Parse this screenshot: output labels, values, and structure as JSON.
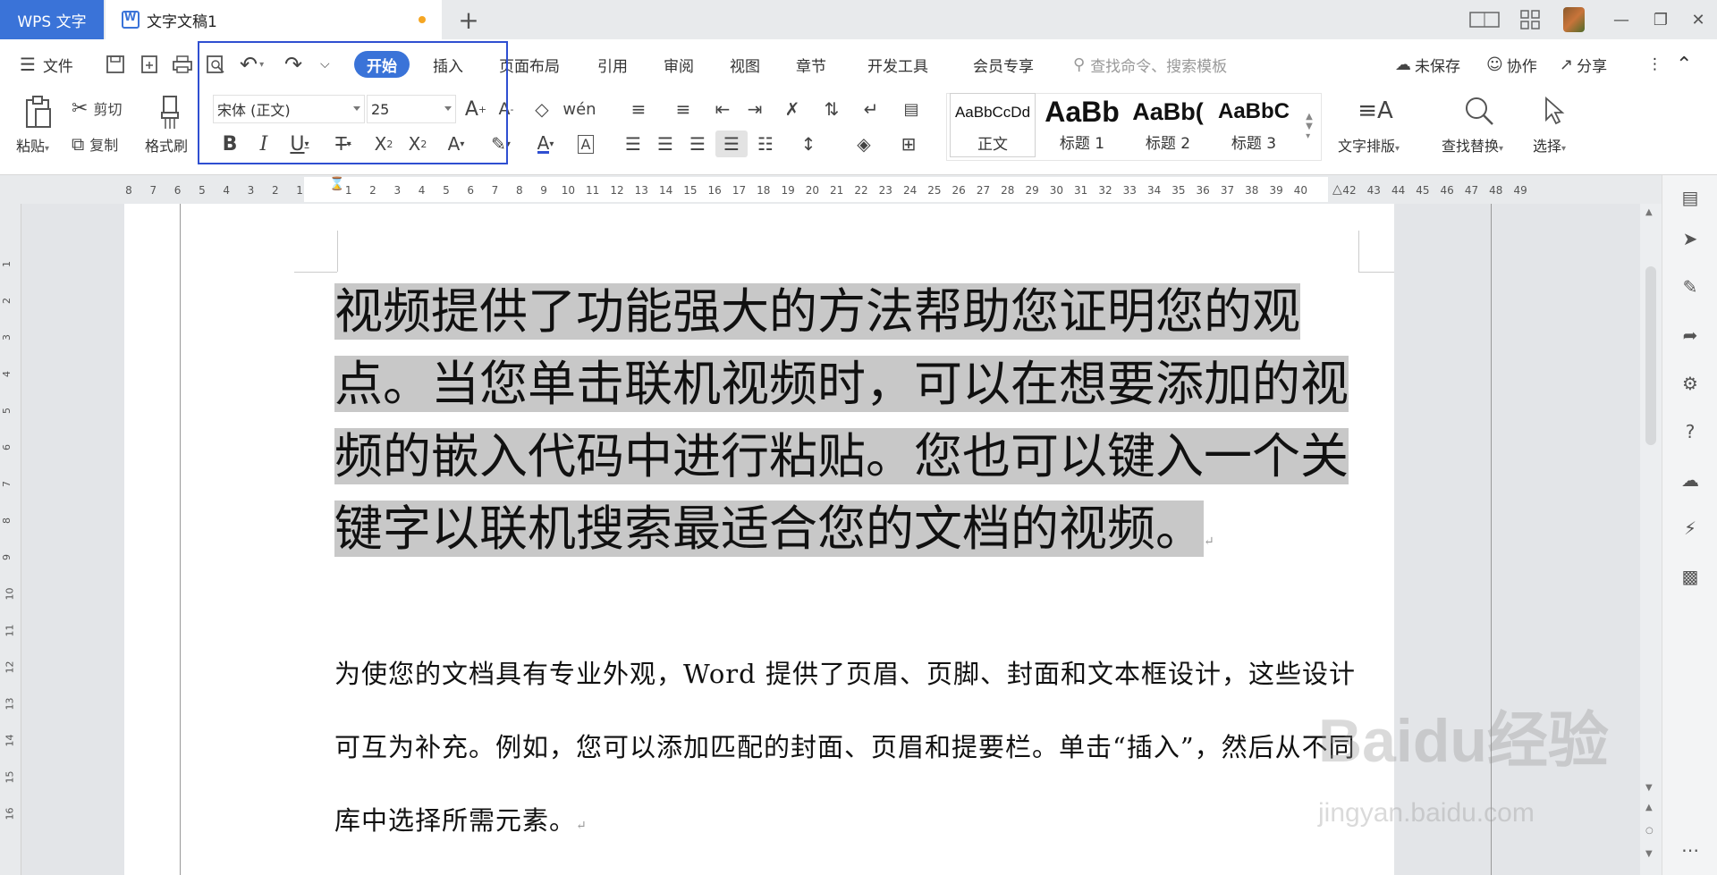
{
  "titlebar": {
    "app_tab": "WPS 文字",
    "doc_tab": "文字文稿1",
    "new_tab_icon": "plus-icon"
  },
  "menu": {
    "file_label": "文件",
    "tabs": [
      "开始",
      "插入",
      "页面布局",
      "引用",
      "审阅",
      "视图",
      "章节",
      "开发工具",
      "会员专享"
    ],
    "active_tab": "开始",
    "search_placeholder": "查找命令、搜索模板",
    "unsaved": "未保存",
    "collab": "协作",
    "share": "分享"
  },
  "ribbon": {
    "paste": "粘贴",
    "cut": "剪切",
    "copy": "复制",
    "format_painter": "格式刷",
    "font_name": "宋体 (正文)",
    "font_size": "25",
    "text_layout": "文字排版",
    "find_replace": "查找替换",
    "select": "选择",
    "styles": [
      {
        "preview": "AaBbCcDd",
        "name": "正文"
      },
      {
        "preview": "AaBb",
        "name": "标题 1"
      },
      {
        "preview": "AaBb(",
        "name": "标题 2"
      },
      {
        "preview": "AaBbC",
        "name": "标题 3"
      }
    ]
  },
  "ruler": {
    "numbers": [
      "8",
      "7",
      "6",
      "5",
      "4",
      "3",
      "2",
      "1",
      "",
      "1",
      "2",
      "3",
      "4",
      "5",
      "6",
      "7",
      "8",
      "9",
      "10",
      "11",
      "12",
      "13",
      "14",
      "15",
      "16",
      "17",
      "18",
      "19",
      "20",
      "21",
      "22",
      "23",
      "24",
      "25",
      "26",
      "27",
      "28",
      "29",
      "30",
      "31",
      "32",
      "33",
      "34",
      "35",
      "36",
      "37",
      "38",
      "39",
      "40",
      "",
      "42",
      "43",
      "44",
      "45",
      "46",
      "47",
      "48",
      "49"
    ]
  },
  "document": {
    "selected_paragraph": "视频提供了功能强大的方法帮助您证明您的观点。当您单击联机视频时，可以在想要添加的视频的嵌入代码中进行粘贴。您也可以键入一个关键字以联机搜索最适合您的文档的视频。",
    "body_paragraph": "为使您的文档具有专业外观，Word 提供了页眉、页脚、封面和文本框设计，这些设计可互为补充。例如，您可以添加匹配的封面、页眉和提要栏。单击“插入”，然后从不同库中选择所需元素。"
  },
  "watermark": {
    "main": "Baidu经验",
    "sub": "jingyan.baidu.com"
  },
  "colors": {
    "accent": "#3a73d8",
    "highlight_box": "#2f4fd1",
    "selection": "#c8c8c8"
  }
}
